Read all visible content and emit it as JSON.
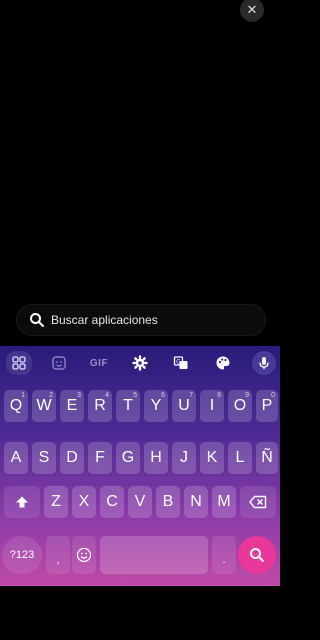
{
  "overlay": {
    "close_label": "✕"
  },
  "search": {
    "placeholder": "Buscar aplicaciones"
  },
  "keyboard": {
    "toolbar": {
      "gif_label": "GIF"
    },
    "row1": [
      {
        "label": "Q",
        "hint": "1"
      },
      {
        "label": "W",
        "hint": "2"
      },
      {
        "label": "E",
        "hint": "3"
      },
      {
        "label": "R",
        "hint": "4"
      },
      {
        "label": "T",
        "hint": "5"
      },
      {
        "label": "Y",
        "hint": "6"
      },
      {
        "label": "U",
        "hint": "7"
      },
      {
        "label": "I",
        "hint": "8"
      },
      {
        "label": "O",
        "hint": "9"
      },
      {
        "label": "P",
        "hint": "0"
      }
    ],
    "row2": [
      "A",
      "S",
      "D",
      "F",
      "G",
      "H",
      "J",
      "K",
      "L",
      "Ñ"
    ],
    "row3": [
      "Z",
      "X",
      "C",
      "V",
      "B",
      "N",
      "M"
    ],
    "row4": {
      "symbols_label": "?123",
      "comma_label": ",",
      "period_label": "."
    },
    "accent_color": "#e8399a"
  }
}
